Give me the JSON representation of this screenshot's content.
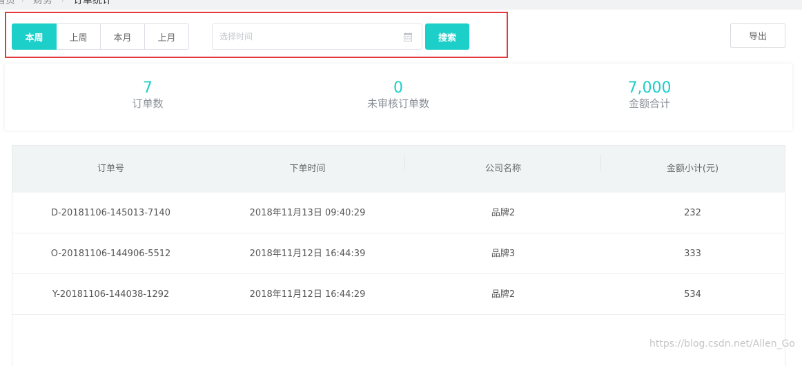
{
  "breadcrumb": {
    "items": [
      "首页",
      "财务",
      "订单统计"
    ],
    "separator": "/"
  },
  "filter": {
    "periods": [
      {
        "label": "本周",
        "active": true
      },
      {
        "label": "上周",
        "active": false
      },
      {
        "label": "本月",
        "active": false
      },
      {
        "label": "上月",
        "active": false
      }
    ],
    "date_placeholder": "选择时间",
    "date_value": "",
    "calendar_icon": "calendar-icon",
    "search_label": "搜索",
    "export_label": "导出"
  },
  "stats": [
    {
      "value": "7",
      "label": "订单数"
    },
    {
      "value": "0",
      "label": "未审核订单数"
    },
    {
      "value": "7,000",
      "label": "金额合计"
    }
  ],
  "table": {
    "columns": [
      "订单号",
      "下单时间",
      "公司名称",
      "金额小计(元)"
    ],
    "rows": [
      {
        "order_no": "D-20181106-145013-7140",
        "time": "2018年11月13日 09:40:29",
        "company": "品牌2",
        "amount": "232"
      },
      {
        "order_no": "O-20181106-144906-5512",
        "time": "2018年11月12日 16:44:39",
        "company": "品牌3",
        "amount": "333"
      },
      {
        "order_no": "Y-20181106-144038-1292",
        "time": "2018年11月12日 16:44:29",
        "company": "品牌2",
        "amount": "534"
      }
    ]
  },
  "colors": {
    "accent": "#1ccfc9",
    "highlight_border": "#e4393c"
  },
  "watermark": "https://blog.csdn.net/Allen_Go"
}
